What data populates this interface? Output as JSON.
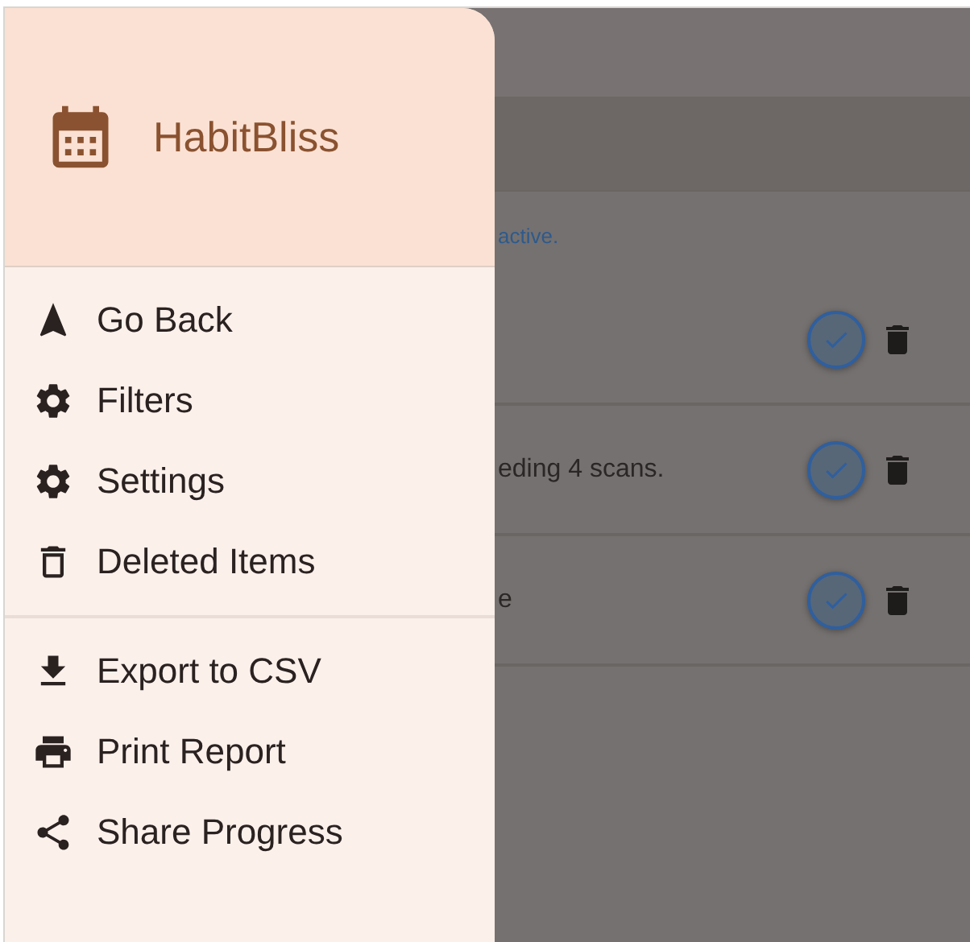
{
  "app": {
    "title": "HabitBliss"
  },
  "menu": [
    [
      {
        "label": "Go Back",
        "kind": "back"
      },
      {
        "label": "Filters",
        "kind": "filters"
      },
      {
        "label": "Settings",
        "kind": "settings"
      },
      {
        "label": "Deleted Items",
        "kind": "deleted"
      }
    ],
    [
      {
        "label": "Export to CSV",
        "kind": "export"
      },
      {
        "label": "Print Report",
        "kind": "print"
      },
      {
        "label": "Share Progress",
        "kind": "share"
      }
    ]
  ],
  "background": {
    "notice": "active.",
    "rows": [
      {
        "text": ""
      },
      {
        "text": "eding 4 scans."
      },
      {
        "text": "e"
      }
    ]
  }
}
